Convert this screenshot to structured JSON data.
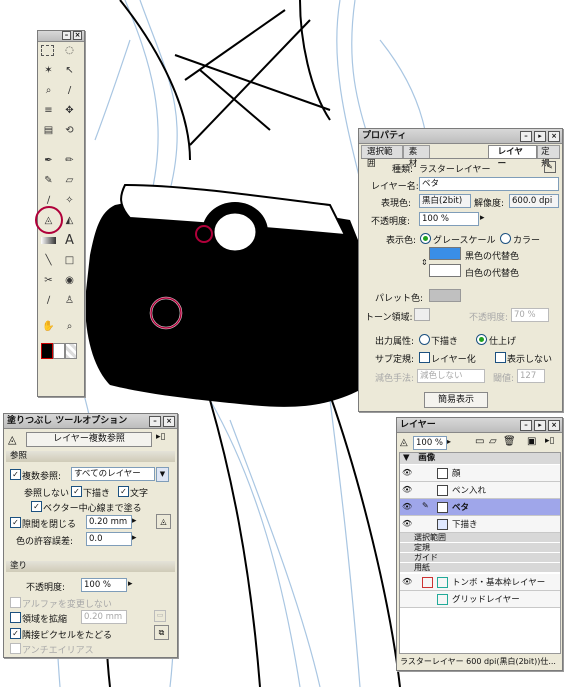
{
  "tools_panel": {
    "title": ""
  },
  "properties_panel": {
    "title": "プロパティ",
    "tabs": [
      "選択範囲",
      "素材",
      "レイヤー",
      "定規"
    ],
    "type_label": "種類:",
    "type_value": "ラスターレイヤー",
    "layer_name_label": "レイヤー名:",
    "layer_name_value": "ベタ",
    "expression_label": "表現色:",
    "expression_value": "黒白(2bit)",
    "resolution_label": "解像度:",
    "resolution_value": "600.0 dpi",
    "opacity_label": "不透明度:",
    "opacity_value": "100 %",
    "display_color_label": "表示色:",
    "grayscale_label": "グレースケール",
    "color_label": "カラー",
    "black_substitute_label": "黒色の代替色",
    "white_substitute_label": "白色の代替色",
    "palette_label": "パレット色:",
    "tone_area_label": "トーン領域:",
    "tone_opacity_label": "不透明度:",
    "tone_opacity_value": "70 %",
    "output_label": "出力属性:",
    "draft_label": "下描き",
    "finish_label": "仕上げ",
    "sub_ruler_label": "サブ定規:",
    "layerize_label": "レイヤー化",
    "hide_label": "表示しない",
    "thinning_label": "減色手法:",
    "thinning_value": "減色しない",
    "threshold_label": "閾値:",
    "threshold_value": "127",
    "simple_display_button": "簡易表示",
    "colors": {
      "black_substitute": "#3a8ee6",
      "white_substitute": "#ffffff",
      "palette": "#c0c0c0"
    }
  },
  "fill_panel": {
    "title": "塗りつぶし ツールオプション",
    "mode_button": "レイヤー複数参照",
    "section_reference": "参照",
    "multi_ref_label": "複数参照:",
    "multi_ref_value": "すべてのレイヤー",
    "no_ref_label": "参照しない",
    "draft_label": "下描き",
    "text_label": "文字",
    "vector_label": "ベクター中心線まで塗る",
    "close_gap_label": "隙間を閉じる",
    "close_gap_value": "0.20 mm",
    "tolerance_label": "色の許容誤差:",
    "tolerance_value": "0.0",
    "section_fill": "塗り",
    "opacity_label": "不透明度:",
    "opacity_value": "100 %",
    "no_alpha_label": "アルファを変更しない",
    "expand_label": "領域を拡縮",
    "expand_value": "0.20 mm",
    "adjacent_label": "隣接ピクセルをたどる",
    "antialias_label": "アンチエイリアス"
  },
  "layers_panel": {
    "title": "レイヤー",
    "zoom_value": "100 %",
    "groups": {
      "image": "画像",
      "selection": "選択範囲",
      "ruler": "定規",
      "guide": "ガイド",
      "paper": "用紙"
    },
    "layers": [
      {
        "name": "顔",
        "selected": false
      },
      {
        "name": "ペン入れ",
        "selected": false
      },
      {
        "name": "ベタ",
        "selected": true
      },
      {
        "name": "下描き",
        "selected": false
      }
    ],
    "paper_layers": [
      "トンボ・基本枠レイヤー",
      "グリッドレイヤー"
    ],
    "status": "ラスターレイヤー 600 dpi(黒白(2bit))仕..."
  }
}
